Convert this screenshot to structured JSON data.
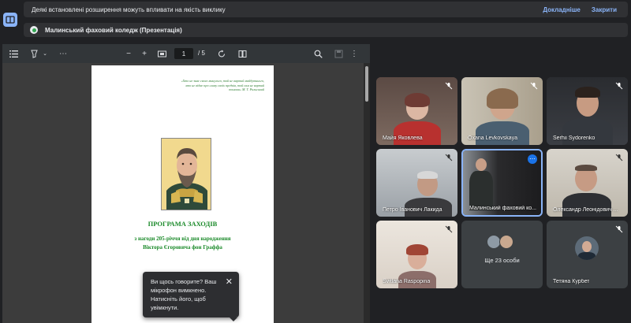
{
  "notice": {
    "text": "Деякі встановлені розширення можуть впливати на якість виклику",
    "details_label": "Докладніше",
    "close_label": "Закрити"
  },
  "presentation": {
    "title": "Малинський фаховий коледж (Презентація)"
  },
  "viewer": {
    "page_current": "1",
    "page_total": "/ 5"
  },
  "document": {
    "epigraph": "«Хто не знає свого минулого, той не вартий майбутнього, хто не відає про славу своїх предків, той сам не вартий пошани» М. Т. Рильський",
    "title": "ПРОГРАМА ЗАХОДІВ",
    "subtitle_line1": "з нагоди 205-річчя від дня народження",
    "subtitle_line2": "Віктора Єгоровича фон Граффа"
  },
  "tooltip": {
    "text": "Ви щось говорите? Ваш мікрофон вимкнено. Натисніть його, щоб увімкнути."
  },
  "participants": [
    {
      "name": "Майя Яковлева"
    },
    {
      "name": "Oxana Levkovskaya"
    },
    {
      "name": "Serhii Sydorenko"
    },
    {
      "name": "Петро Іванович Лакида"
    },
    {
      "name": "Малинський фаховий ко..."
    },
    {
      "name": "Олександр Леонідович ..."
    },
    {
      "name": "Svitlana Raspopina"
    },
    {
      "name": "Тетяна Курбет"
    }
  ],
  "overflow": {
    "label": "Ще 23 особи"
  },
  "colors": {
    "accent": "#8ab4f8",
    "doc_green": "#1b8a2a",
    "background": "#202124"
  }
}
